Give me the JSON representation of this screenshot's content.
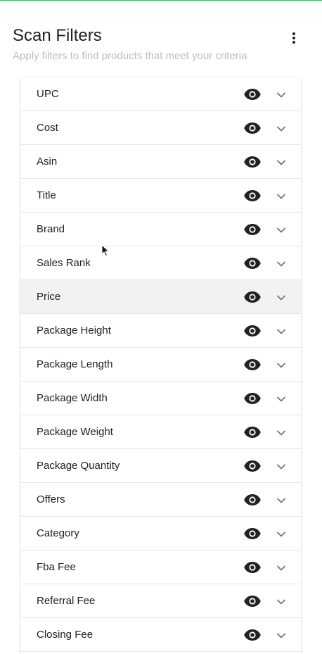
{
  "header": {
    "title": "Scan Filters",
    "subtitle": "Apply filters to find products that meet your criteria",
    "more_icon": "more-vert-icon"
  },
  "colors": {
    "accent_line": "#2bbf55",
    "active_row": "#f2f2f2",
    "icon": "#222222",
    "chevron": "#757575"
  },
  "filters": [
    {
      "label": "UPC"
    },
    {
      "label": "Cost"
    },
    {
      "label": "Asin"
    },
    {
      "label": "Title"
    },
    {
      "label": "Brand"
    },
    {
      "label": "Sales Rank"
    },
    {
      "label": "Price",
      "active": true
    },
    {
      "label": "Package Height"
    },
    {
      "label": "Package Length"
    },
    {
      "label": "Package Width"
    },
    {
      "label": "Package Weight"
    },
    {
      "label": "Package Quantity"
    },
    {
      "label": "Offers"
    },
    {
      "label": "Category"
    },
    {
      "label": "Fba Fee"
    },
    {
      "label": "Referral Fee"
    },
    {
      "label": "Closing Fee"
    },
    {
      "label": ""
    }
  ]
}
